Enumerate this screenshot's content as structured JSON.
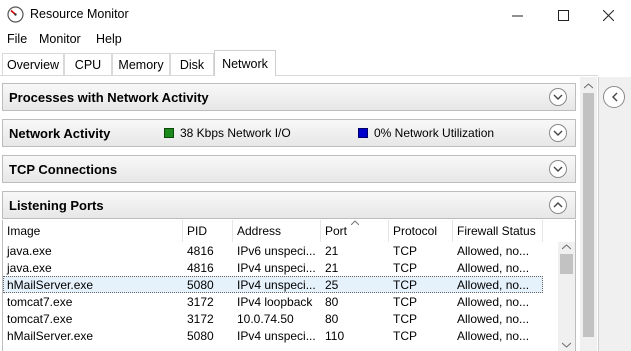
{
  "window": {
    "title": "Resource Monitor"
  },
  "menu": [
    "File",
    "Monitor",
    "Help"
  ],
  "tabs": [
    "Overview",
    "CPU",
    "Memory",
    "Disk",
    "Network"
  ],
  "panels": {
    "processes": "Processes with Network Activity",
    "activity": "Network Activity",
    "activity_io": "38 Kbps Network I/O",
    "activity_util": "0% Network Utilization",
    "tcp": "TCP Connections",
    "listening": "Listening Ports"
  },
  "colors": {
    "io_legend": "#1a8a1a",
    "util_legend": "#0000cc"
  },
  "table": {
    "columns": [
      "Image",
      "PID",
      "Address",
      "Port",
      "Protocol",
      "Firewall Status"
    ],
    "rows": [
      [
        "java.exe",
        "4816",
        "IPv6 unspeci...",
        "21",
        "TCP",
        "Allowed, no..."
      ],
      [
        "java.exe",
        "4816",
        "IPv4 unspeci...",
        "21",
        "TCP",
        "Allowed, no..."
      ],
      [
        "hMailServer.exe",
        "5080",
        "IPv4 unspeci...",
        "25",
        "TCP",
        "Allowed, no..."
      ],
      [
        "tomcat7.exe",
        "3172",
        "IPv4 loopback",
        "80",
        "TCP",
        "Allowed, no..."
      ],
      [
        "tomcat7.exe",
        "3172",
        "10.0.74.50",
        "80",
        "TCP",
        "Allowed, no..."
      ],
      [
        "hMailServer.exe",
        "5080",
        "IPv4 unspeci...",
        "110",
        "TCP",
        "Allowed, no..."
      ]
    ],
    "selected_row": 2
  }
}
